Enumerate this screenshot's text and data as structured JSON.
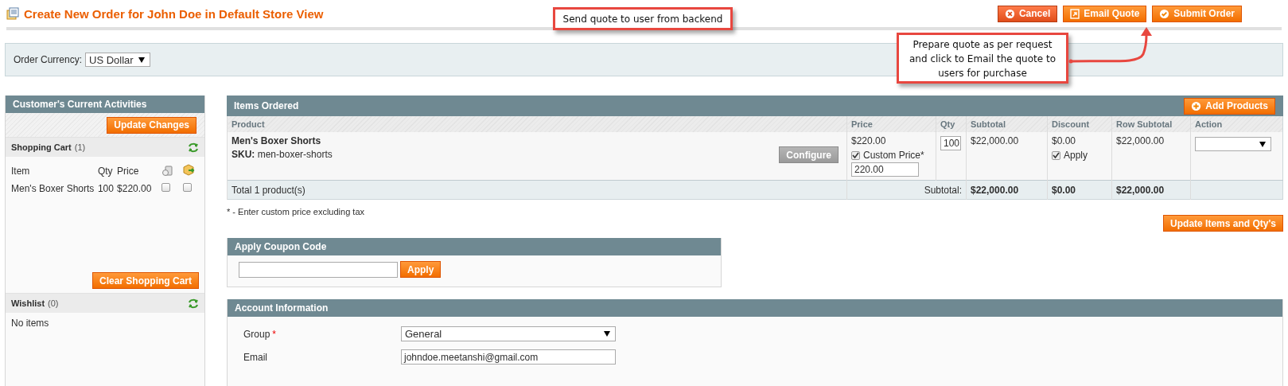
{
  "header": {
    "title": "Create New Order for John Doe in Default Store View",
    "buttons": [
      {
        "label": "Cancel",
        "kind": "cancel"
      },
      {
        "label": "Email Quote",
        "kind": "email"
      },
      {
        "label": "Submit Order",
        "kind": "submit"
      }
    ]
  },
  "callouts": [
    {
      "text": "Send quote to user from backend",
      "kind": "top"
    },
    {
      "text": "Prepare quote as per request and click to Email the quote to users for purchase",
      "kind": "arrow"
    }
  ],
  "currency": {
    "label": "Order Currency:",
    "value": "US Dollar"
  },
  "sidebar": {
    "title": "Customer's Current Activities",
    "update_button": "Update Changes",
    "cart": {
      "title": "Shopping Cart",
      "count": "(1)",
      "columns": [
        "Item",
        "Qty",
        "Price"
      ],
      "items": [
        {
          "name": "Men's Boxer Shorts",
          "qty": "100",
          "price": "$220.00",
          "remove_checked": false,
          "move_checked": false
        }
      ],
      "clear_button": "Clear Shopping Cart"
    },
    "wishlist": {
      "title": "Wishlist",
      "count": "(0)",
      "empty": "No items"
    }
  },
  "items_ordered": {
    "title": "Items Ordered",
    "add_button": "Add Products",
    "columns": [
      "Product",
      "Price",
      "Qty",
      "Subtotal",
      "Discount",
      "Row Subtotal",
      "Action"
    ],
    "rows": [
      {
        "name": "Men's Boxer Shorts",
        "sku_label": "SKU:",
        "sku": "men-boxer-shorts",
        "configure": "Configure",
        "price": "$220.00",
        "custom_price_checked": true,
        "custom_price_label": "Custom Price*",
        "custom_price": "220.00",
        "qty": "100",
        "subtotal": "$22,000.00",
        "discount": "$0.00",
        "apply_checked": true,
        "apply_label": "Apply",
        "row_subtotal": "$22,000.00"
      }
    ],
    "total": {
      "label": "Total 1 product(s)",
      "subtotal_label": "Subtotal:",
      "subtotal": "$22,000.00",
      "discount": "$0.00",
      "row_subtotal": "$22,000.00"
    },
    "note": "* - Enter custom price excluding tax",
    "update_button": "Update Items and Qty's"
  },
  "coupon": {
    "title": "Apply Coupon Code",
    "apply_button": "Apply"
  },
  "account": {
    "title": "Account Information",
    "fields": [
      {
        "label": "Group",
        "required_mark": "*",
        "kind": "select",
        "value": "General"
      },
      {
        "label": "Email",
        "kind": "input",
        "value": "johndoe.meetanshi@gmail.com"
      }
    ]
  }
}
